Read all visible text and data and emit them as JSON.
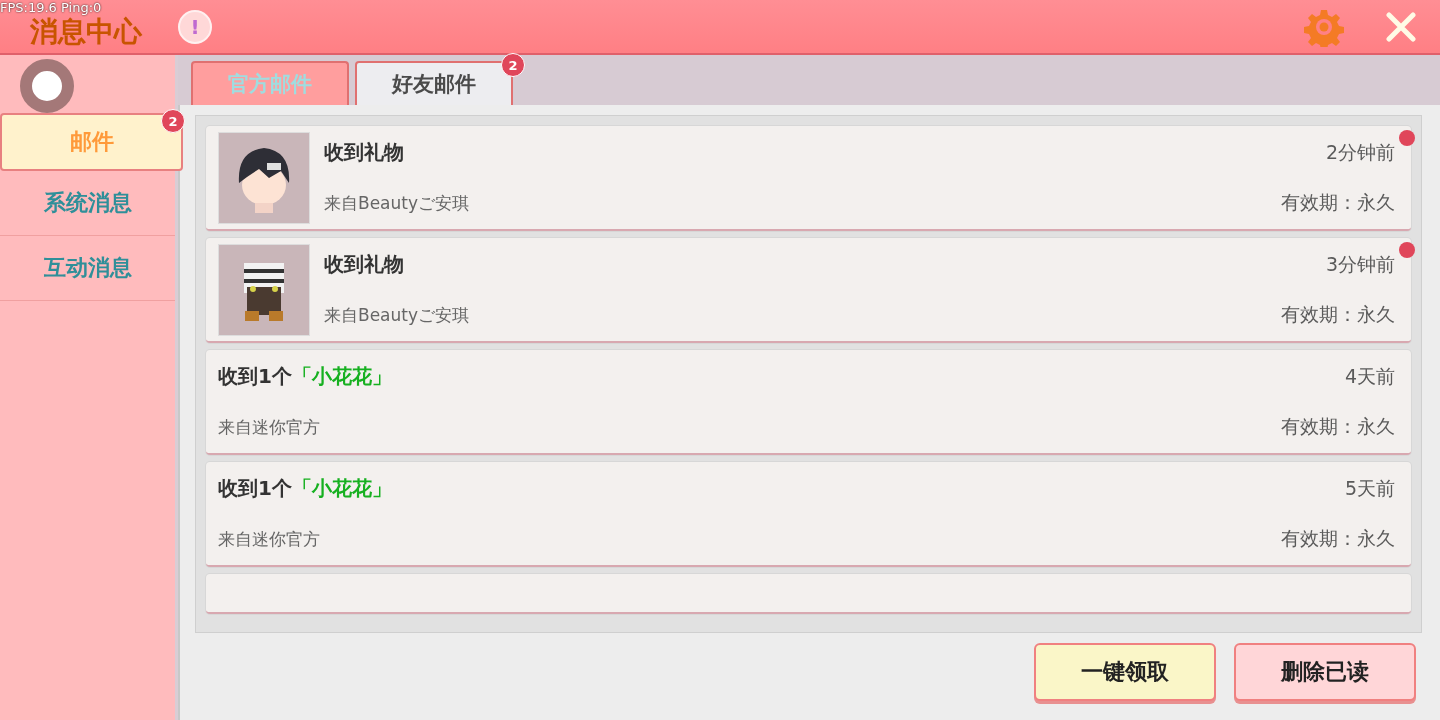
{
  "debug_overlay": "FPS:19.6  Ping:0",
  "header": {
    "title": "消息中心",
    "alert_icon": "!"
  },
  "sidebar": {
    "items": [
      {
        "label": "邮件",
        "selected": true,
        "badge": "2"
      },
      {
        "label": "系统消息",
        "selected": false
      },
      {
        "label": "互动消息",
        "selected": false
      }
    ]
  },
  "tabs": [
    {
      "label": "官方邮件",
      "selected": false
    },
    {
      "label": "好友邮件",
      "selected": true,
      "badge": "2"
    }
  ],
  "mails": [
    {
      "kind": "gift",
      "title": "收到礼物",
      "sender": "来自Beautyご安琪",
      "time": "2分钟前",
      "validity": "有效期：永久",
      "unread": true
    },
    {
      "kind": "gift",
      "title": "收到礼物",
      "sender": "来自Beautyご安琪",
      "time": "3分钟前",
      "validity": "有效期：永久",
      "unread": true
    },
    {
      "kind": "item",
      "title": "收到1个",
      "highlight": "「小花花」",
      "sender": "来自迷你官方",
      "time": "4天前",
      "validity": "有效期：永久",
      "unread": false
    },
    {
      "kind": "item",
      "title": "收到1个",
      "highlight": "「小花花」",
      "sender": "来自迷你官方",
      "time": "5天前",
      "validity": "有效期：永久",
      "unread": false
    }
  ],
  "buttons": [
    {
      "label": "一键领取",
      "kind": "claim"
    },
    {
      "label": "删除已读",
      "kind": "delete"
    }
  ]
}
